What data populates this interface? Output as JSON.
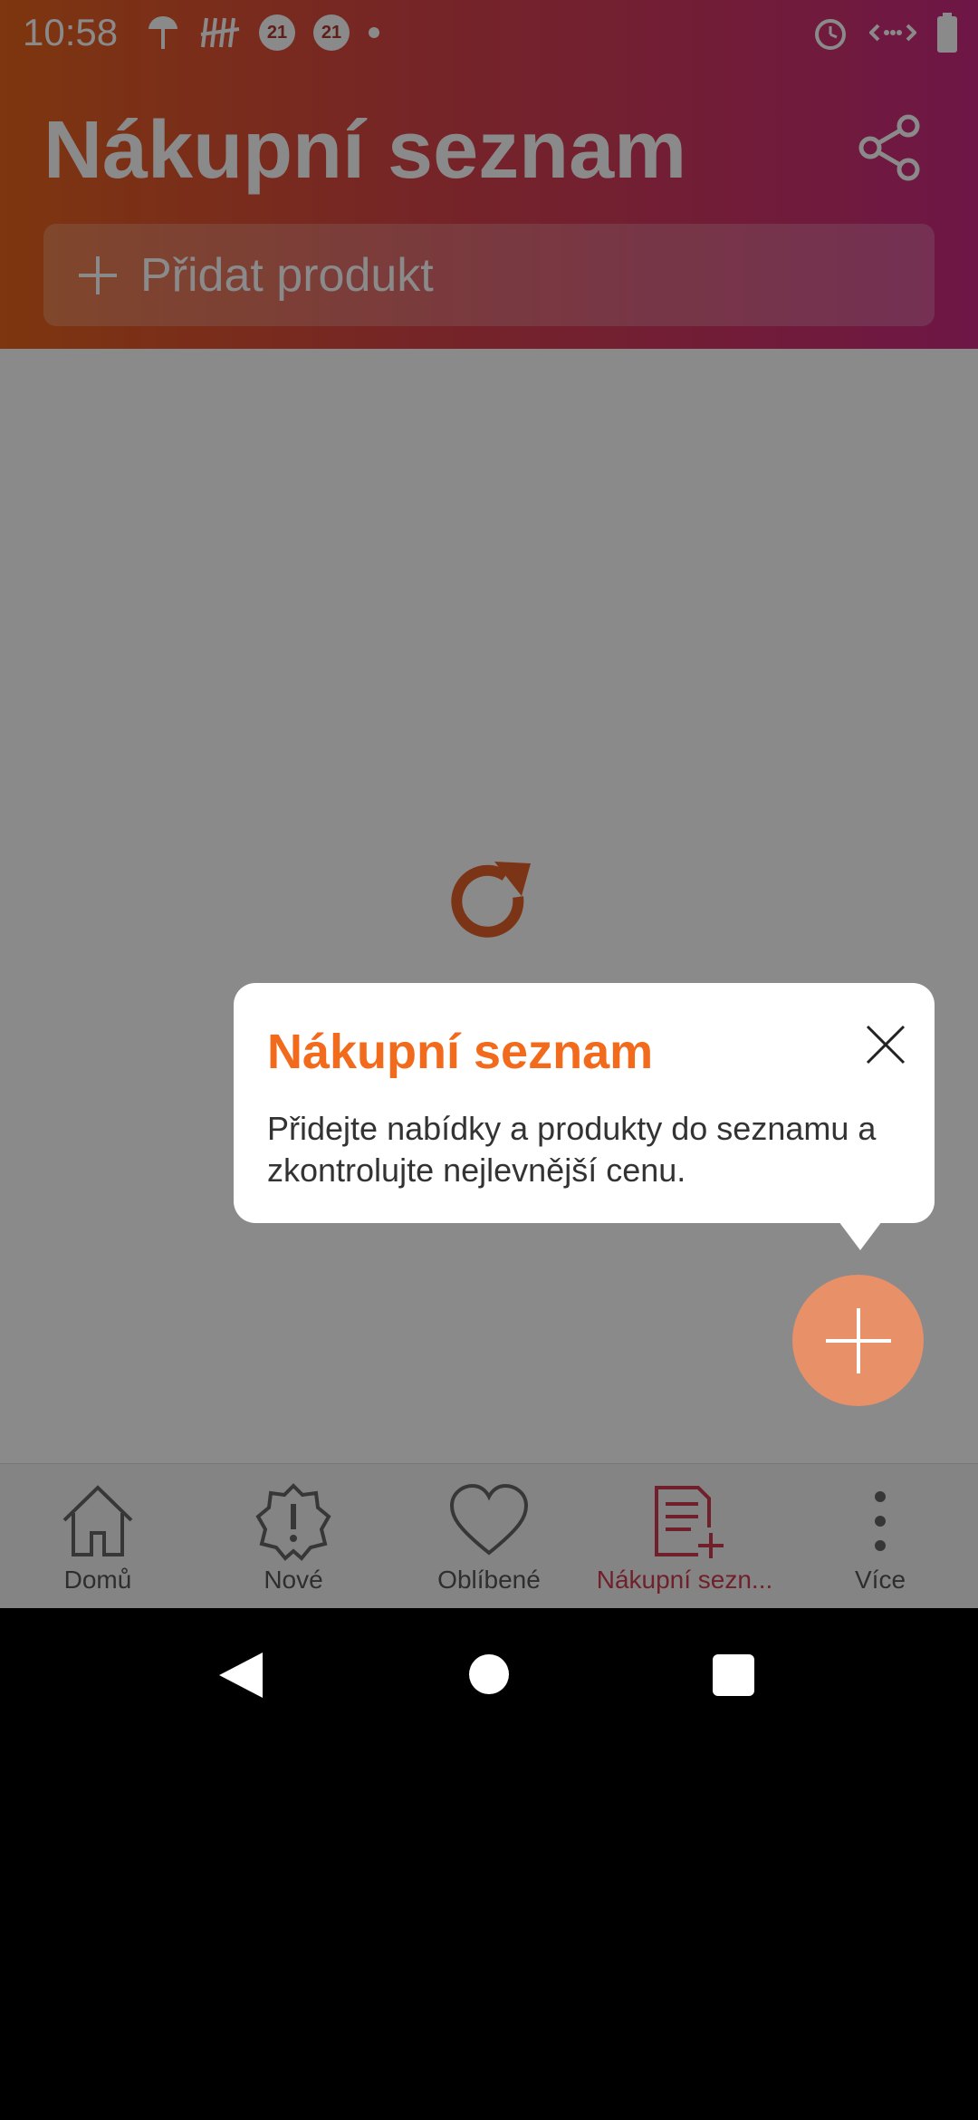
{
  "status_bar": {
    "time": "10:58",
    "badge_1": "21",
    "badge_2": "21",
    "icons": [
      "umbrella-icon",
      "signal-marks-icon",
      "alarm-icon",
      "data-icon",
      "battery-icon"
    ]
  },
  "header": {
    "title": "Nákupní seznam",
    "add_placeholder": "Přidat produkt",
    "share_icon": "share-icon"
  },
  "tooltip": {
    "title": "Nákupní seznam",
    "text": "Přidejte nabídky a produkty do seznamu a zkontrolujte nejlevnější cenu."
  },
  "bottom_nav": {
    "items": [
      {
        "label": "Domů",
        "icon": "home-icon"
      },
      {
        "label": "Nové",
        "icon": "new-icon"
      },
      {
        "label": "Oblíbené",
        "icon": "heart-icon"
      },
      {
        "label": "Nákupní sezn...",
        "icon": "shopping-list-icon",
        "active": true
      },
      {
        "label": "Více",
        "icon": "more-icon"
      }
    ]
  },
  "colors": {
    "accent": "#f26a1b",
    "active_nav": "#d03c4e",
    "fab": "#e89068"
  }
}
